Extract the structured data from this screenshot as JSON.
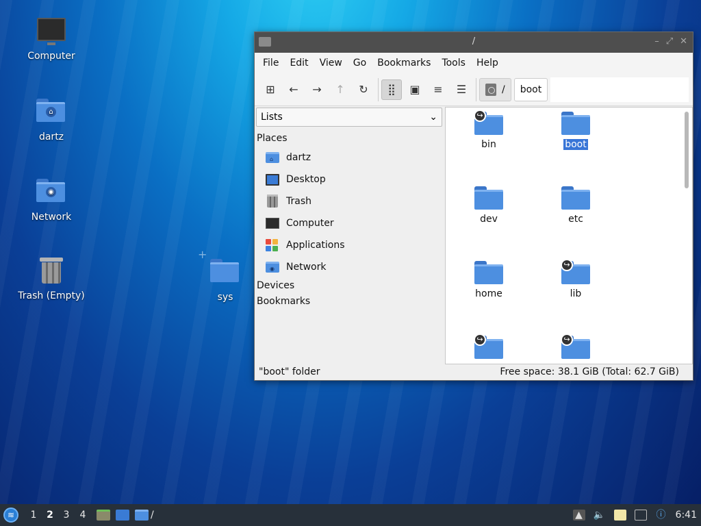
{
  "desktop": {
    "icons": [
      {
        "label": "Computer"
      },
      {
        "label": "dartz"
      },
      {
        "label": "Network"
      },
      {
        "label": "Trash (Empty)"
      },
      {
        "label": "sys"
      }
    ]
  },
  "window": {
    "title": "/",
    "menu": [
      "File",
      "Edit",
      "View",
      "Go",
      "Bookmarks",
      "Tools",
      "Help"
    ],
    "breadcrumb": [
      "/",
      "boot"
    ],
    "side_panel_mode": "Lists",
    "sections": {
      "places": "Places",
      "devices": "Devices",
      "bookmarks": "Bookmarks"
    },
    "places": [
      "dartz",
      "Desktop",
      "Trash",
      "Computer",
      "Applications",
      "Network"
    ],
    "files": [
      {
        "name": "bin",
        "symlink": true
      },
      {
        "name": "boot",
        "symlink": false,
        "selected": true
      },
      {
        "name": "dev",
        "symlink": false
      },
      {
        "name": "etc",
        "symlink": false
      },
      {
        "name": "home",
        "symlink": false
      },
      {
        "name": "lib",
        "symlink": true
      },
      {
        "name": "",
        "symlink": true
      },
      {
        "name": "",
        "symlink": true
      }
    ],
    "status_left": "\"boot\" folder",
    "status_right": "Free space: 38.1 GiB (Total: 62.7 GiB)"
  },
  "taskbar": {
    "workspaces": [
      "1",
      "2",
      "3",
      "4"
    ],
    "current_workspace": "2",
    "task_label": "/",
    "clock": "6:41"
  },
  "colors": {
    "accent": "#3875d7",
    "folder": "#4d8fe0",
    "taskbar": "#27303a"
  }
}
